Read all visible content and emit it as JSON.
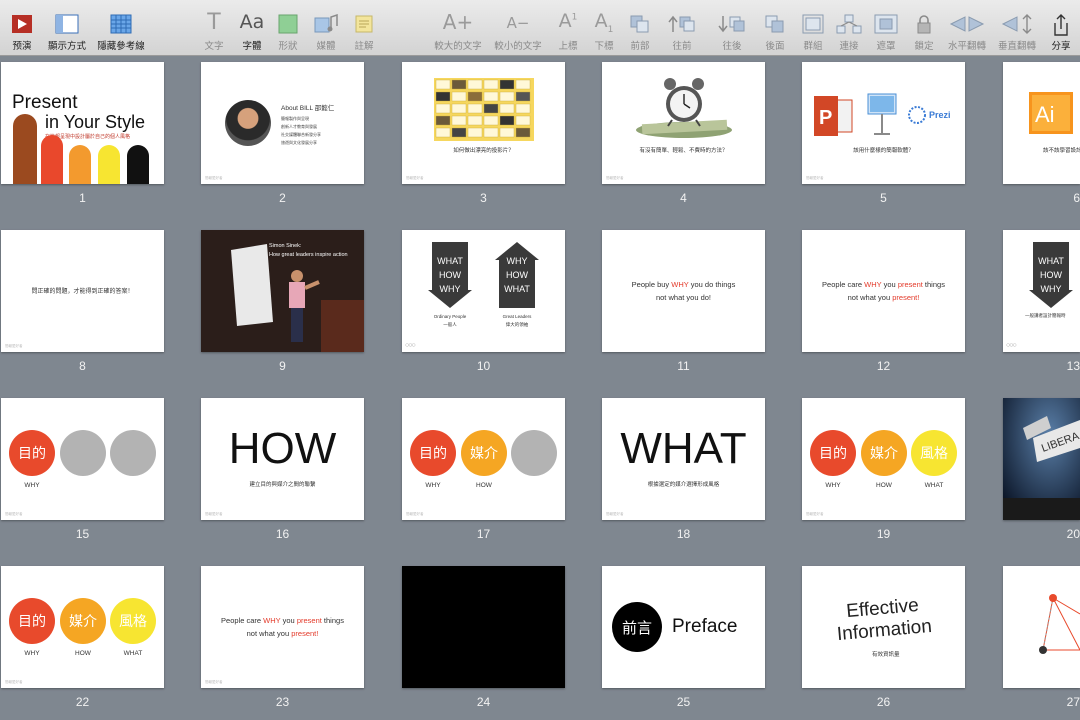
{
  "toolbar": {
    "play": "预演",
    "view": "顯示方式",
    "guides": "隱藏參考線",
    "text": "文字",
    "font": "字體",
    "shape": "形狀",
    "media": "媒體",
    "comment": "註解",
    "bigger": "較大的文字",
    "smaller": "較小的文字",
    "superscript": "上標",
    "subscript": "下標",
    "front": "前部",
    "forward": "往前",
    "backward": "往後",
    "back": "後面",
    "group": "群組",
    "connect": "連接",
    "mask": "遮罩",
    "lock": "鎖定",
    "flip_h": "水平翻轉",
    "flip_v": "垂直翻轉",
    "share": "分享"
  },
  "slides": [
    {
      "n": "1",
      "title1": "Present",
      "title2": "in Your Style",
      "sub": "在簡報呈現中設計屬於自己的個人風格",
      "foot": "簡報愛好者"
    },
    {
      "n": "2",
      "about": "About BILL 邵懿仁",
      "l1": "簡報製作與呈現",
      "l2": "創新人才教育與發展",
      "l3": "社交媒體聯合新發分享",
      "l4": "旅遊與文化發展分享",
      "foot": "簡報愛好者"
    },
    {
      "n": "3",
      "cap": "如何做出漂亮的投影片？",
      "foot": "簡報愛好者"
    },
    {
      "n": "4",
      "cap": "有沒有簡單、輕鬆、不費時的方法？",
      "foot": "簡報愛好者"
    },
    {
      "n": "5",
      "prezi": "Prezi",
      "cap": "該用什麼樣的簡報軟體？",
      "foot": "簡報愛好者"
    },
    {
      "n": "8",
      "cap": "問正確的問題，才能得到正確的答案！",
      "foot": "簡報愛好者"
    },
    {
      "n": "9",
      "l1": "Simon Sinek:",
      "l2": "How great leaders inspire action"
    },
    {
      "n": "10",
      "what": "WHAT",
      "how": "HOW",
      "why": "WHY",
      "left1": "Ordinary People",
      "left2": "一般人",
      "right1": "Great Leaders",
      "right2": "偉大的領袖"
    },
    {
      "n": "11",
      "l1a": "People buy ",
      "l1b": "WHY",
      "l1c": " you do things",
      "l2": "not what you do!"
    },
    {
      "n": "12",
      "l1a": "People care ",
      "l1b": "WHY",
      "l1c": " you ",
      "l1d": "present",
      "l1e": " things",
      "l2a": "not what you ",
      "l2b": "present!"
    },
    {
      "n": "15",
      "c1": "目的",
      "w1": "WHY"
    },
    {
      "n": "16",
      "big": "HOW",
      "cap": "建立目的與媒介之間的聯繫"
    },
    {
      "n": "17",
      "c1": "目的",
      "c2": "媒介",
      "w1": "WHY",
      "w2": "HOW"
    },
    {
      "n": "18",
      "big": "WHAT",
      "cap": "根據選定的媒介選擇形成風格"
    },
    {
      "n": "19",
      "c1": "目的",
      "c2": "媒介",
      "c3": "風格",
      "w1": "WHY",
      "w2": "HOW",
      "w3": "WHAT"
    },
    {
      "n": "22",
      "c1": "目的",
      "c2": "媒介",
      "c3": "風格",
      "w1": "WHY",
      "w2": "HOW",
      "w3": "WHAT"
    },
    {
      "n": "23",
      "l1a": "People care ",
      "l1b": "WHY",
      "l1c": " you ",
      "l1d": "present",
      "l1e": " things",
      "l2a": "not what you ",
      "l2b": "present!"
    },
    {
      "n": "24"
    },
    {
      "n": "25",
      "zh": "前言",
      "en": "Preface"
    },
    {
      "n": "26",
      "l1": "Effective",
      "l2": "Information",
      "cap": "有效資訊量"
    }
  ],
  "partial": {
    "n6": "6",
    "cap6": "該不該學習設計？",
    "n13": "13",
    "what": "WHAT",
    "how": "HOW",
    "why": "WHY",
    "cap13": "一般講者設計簡報時",
    "n20": "20",
    "n27": "27"
  }
}
